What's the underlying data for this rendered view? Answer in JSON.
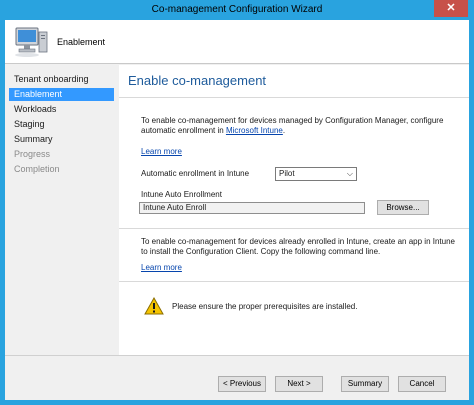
{
  "window": {
    "title": "Co-management Configuration Wizard",
    "close_glyph": "✕"
  },
  "header": {
    "heading": "Enablement",
    "icon": "computer-icon"
  },
  "nav": {
    "items": [
      {
        "label": "Tenant onboarding",
        "state": "normal"
      },
      {
        "label": "Enablement",
        "state": "active"
      },
      {
        "label": "Workloads",
        "state": "normal"
      },
      {
        "label": "Staging",
        "state": "normal"
      },
      {
        "label": "Summary",
        "state": "normal"
      },
      {
        "label": "Progress",
        "state": "disabled"
      },
      {
        "label": "Completion",
        "state": "disabled"
      }
    ]
  },
  "main": {
    "title": "Enable co-management",
    "intro_line1": "To enable co-management for devices managed by Configuration Manager, configure",
    "intro_line2_prefix": "automatic enrollment in ",
    "intro_link": "Microsoft Intune",
    "intro_line2_suffix": ".",
    "learn_more_1": "Learn more",
    "auto_enroll_label": "Automatic enrollment in Intune",
    "auto_enroll_value": "Pilot",
    "intune_auto_label": "Intune Auto Enrollment",
    "intune_auto_value": "Intune Auto Enroll",
    "browse_label": "Browse...",
    "enrolled_line1": "To enable co-management for devices already enrolled in Intune, create an app in Intune",
    "enrolled_line2": "to install the Configuration Client. Copy the following command line.",
    "learn_more_2": "Learn more",
    "warning_text": "Please ensure the proper prerequisites are installed.",
    "warning_icon": "warning-icon"
  },
  "footer": {
    "previous": "< Previous",
    "next": "Next >",
    "summary": "Summary",
    "cancel": "Cancel"
  },
  "colors": {
    "accent": "#29a3df",
    "nav_active": "#3399ff",
    "title_blue": "#1e5b9b",
    "link": "#0645ad"
  }
}
